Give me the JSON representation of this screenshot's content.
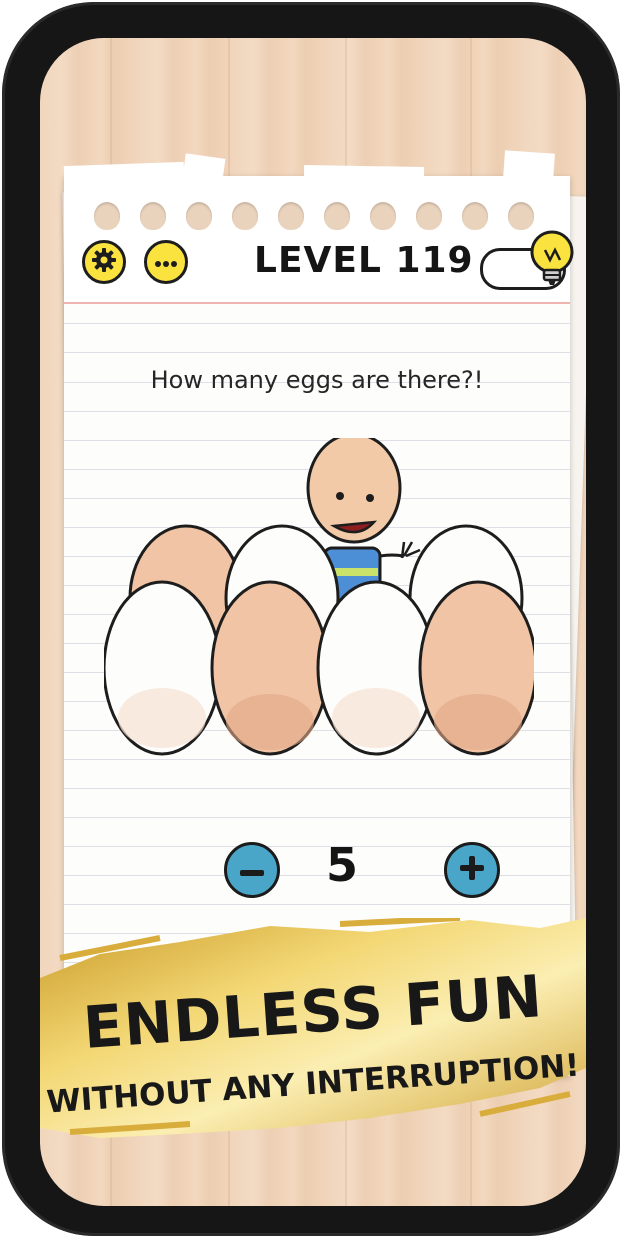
{
  "header": {
    "level_label": "LEVEL 119",
    "settings_icon": "gear-icon",
    "menu_icon": "more-dots-icon",
    "hint_icon": "lightbulb-icon"
  },
  "puzzle": {
    "question": "How many eggs are there?!",
    "answer_count": "5",
    "decrement_icon": "minus-icon",
    "increment_icon": "plus-icon"
  },
  "promo": {
    "title": "ENDLESS FUN",
    "subtitle": "WITHOUT ANY INTERRUPTION!"
  },
  "colors": {
    "button_yellow": "#fbe33f",
    "stepper_blue": "#4aa6c9",
    "egg_white": "#fdfdfc",
    "egg_brown": "#f0c4a4",
    "banner_gold": "#d8b23a"
  }
}
